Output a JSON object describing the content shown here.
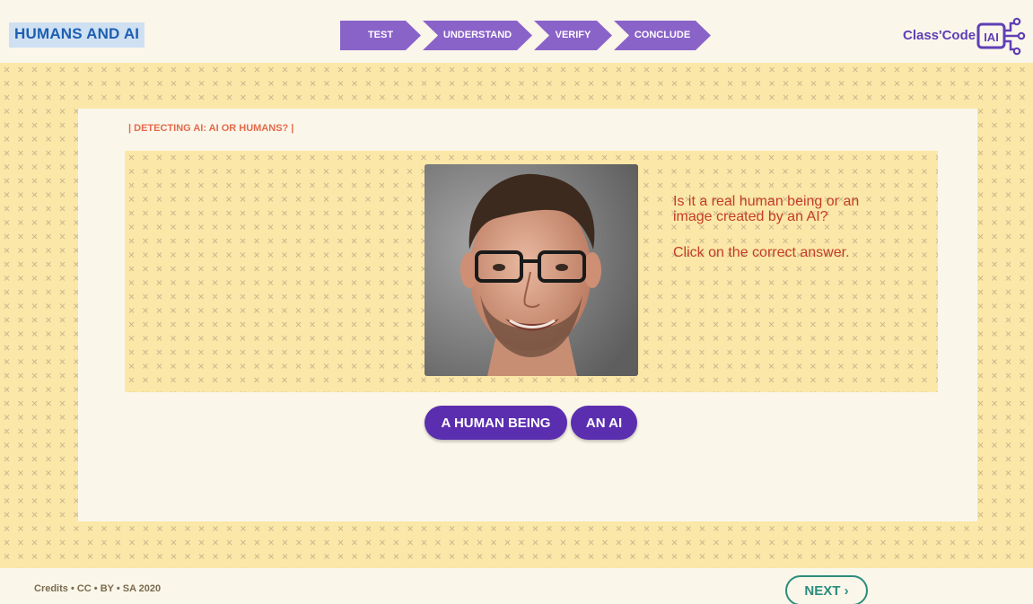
{
  "header": {
    "app_title": "HUMANS AND AI",
    "steps": [
      {
        "label": "TEST"
      },
      {
        "label": "UNDERSTAND"
      },
      {
        "label": "VERIFY"
      },
      {
        "label": "CONCLUDE"
      }
    ],
    "brand": {
      "text": "Class'Code",
      "logo_text": "IAI"
    }
  },
  "activity": {
    "section_label": "| DETECTING AI: AI OR HUMANS? |",
    "question": "Is it a real human being or an image created by an AI?",
    "instruction": "Click on the correct answer.",
    "answers": [
      {
        "label": "A HUMAN BEING"
      },
      {
        "label": "AN AI"
      }
    ]
  },
  "footer": {
    "credits": "Credits • CC • BY • SA 2020",
    "next_label": "NEXT ›"
  },
  "colors": {
    "background": "#faf6ea",
    "pattern": "#fbe7a7",
    "step": "#8a63c9",
    "button": "#5b2eb0",
    "accent_text": "#c43c27",
    "next": "#2b8c7c",
    "brand": "#5f3fb5"
  }
}
